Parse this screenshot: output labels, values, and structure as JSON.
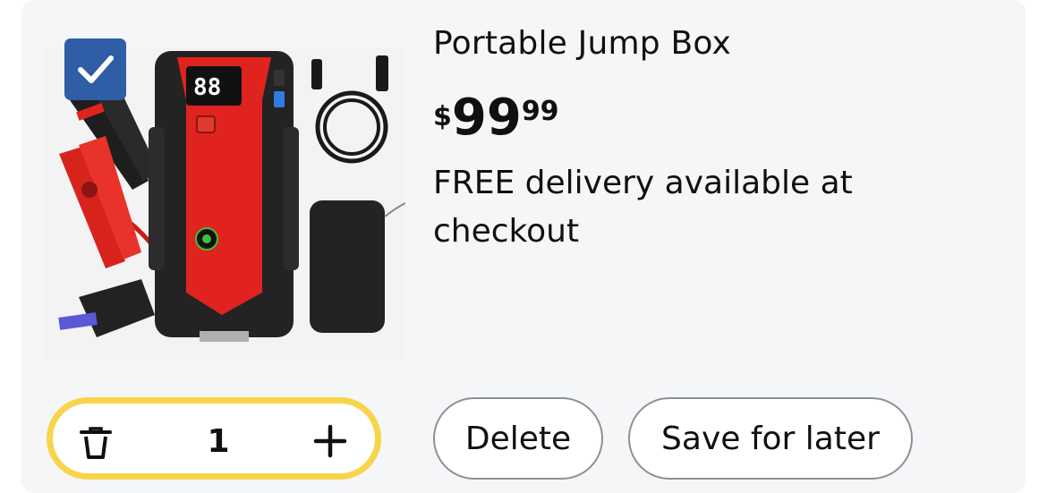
{
  "item": {
    "selected": true,
    "title": "Portable Jump Box",
    "price": {
      "currency": "$",
      "whole": "99",
      "fraction": "99"
    },
    "delivery": "FREE delivery available at checkout",
    "image_icon": "jump-starter-product-image",
    "display_readout": "88"
  },
  "quantity": {
    "value": "1",
    "trash_icon": "trash-icon",
    "plus_icon": "plus-icon"
  },
  "actions": {
    "delete_label": "Delete",
    "save_label": "Save for later"
  },
  "colors": {
    "card_bg": "#f5f6f8",
    "checkbox": "#2f5da6",
    "qty_border": "#f6d54a",
    "button_border": "#8d9096",
    "product_red": "#e0231f"
  }
}
